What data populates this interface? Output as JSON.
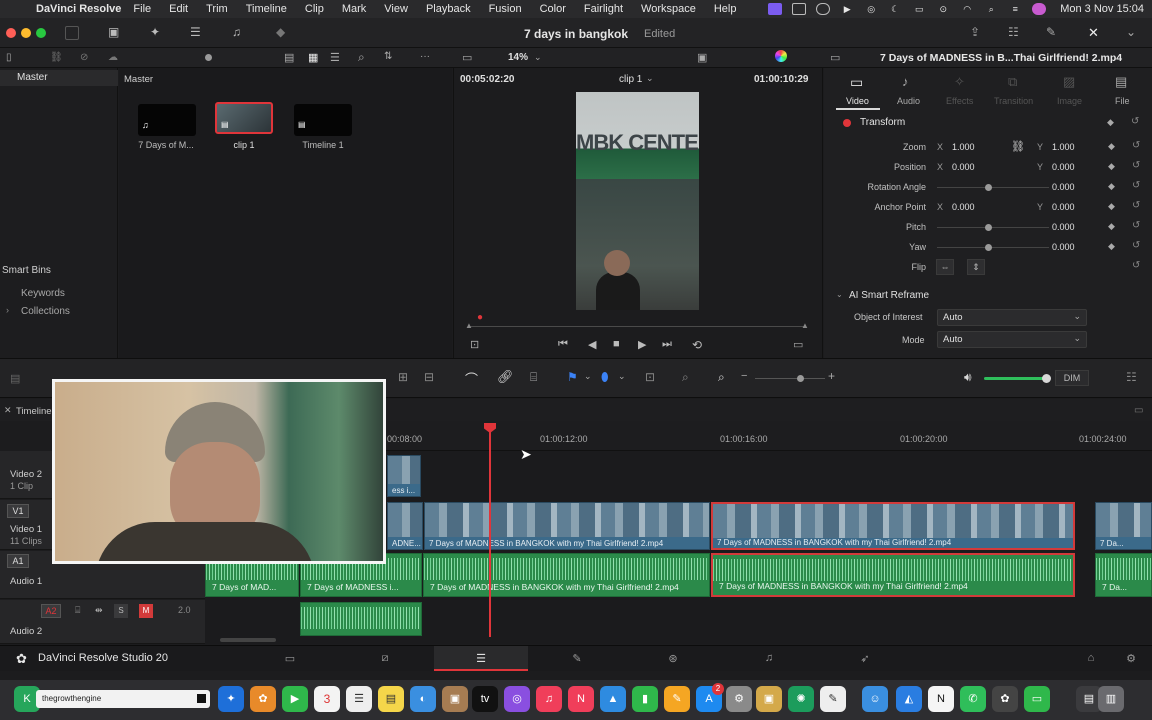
{
  "menubar": {
    "app_name": "DaVinci Resolve",
    "items": [
      "File",
      "Edit",
      "Trim",
      "Timeline",
      "Clip",
      "Mark",
      "View",
      "Playback",
      "Fusion",
      "Color",
      "Fairlight",
      "Workspace",
      "Help"
    ],
    "clock": "Mon 3 Nov  15:04"
  },
  "toolbar": {
    "project_title": "7 days in bangkok",
    "edited_label": "Edited"
  },
  "media_pool": {
    "header_left": "Master",
    "header_right": "Master",
    "smart_bins": "Smart Bins",
    "keywords": "Keywords",
    "collections": "Collections",
    "clips": [
      {
        "name": "7 Days of M..."
      },
      {
        "name": "clip 1"
      },
      {
        "name": "Timeline 1"
      }
    ]
  },
  "viewer": {
    "zoom": "14%",
    "timecode_left": "00:05:02:20",
    "clip_name": "clip 1",
    "timecode_right": "01:00:10:29",
    "sign_text": "MBK CENTER"
  },
  "inspector": {
    "clip_title": "7 Days of MADNESS in B...Thai Girlfriend! 2.mp4",
    "tabs": [
      "Video",
      "Audio",
      "Effects",
      "Transition",
      "Image",
      "File"
    ],
    "section_transform": "Transform",
    "rows": [
      {
        "name": "Zoom",
        "x_label": "X",
        "x": "1.000",
        "y_label": "Y",
        "y": "1.000"
      },
      {
        "name": "Position",
        "x_label": "X",
        "x": "0.000",
        "y_label": "Y",
        "y": "0.000"
      },
      {
        "name": "Rotation Angle",
        "y": "0.000"
      },
      {
        "name": "Anchor Point",
        "x_label": "X",
        "x": "0.000",
        "y_label": "Y",
        "y": "0.000"
      },
      {
        "name": "Pitch",
        "y": "0.000"
      },
      {
        "name": "Yaw",
        "y": "0.000"
      },
      {
        "name": "Flip"
      }
    ],
    "section_reframe": "AI Smart Reframe",
    "object_label": "Object of Interest",
    "object_value": "Auto",
    "mode_label": "Mode",
    "mode_value": "Auto"
  },
  "timeline": {
    "tab_label": "Timeline",
    "ruler": [
      "00:08:00",
      "01:00:12:00",
      "01:00:16:00",
      "01:00:20:00",
      "01:00:24:00"
    ],
    "dim_label": "DIM",
    "tracks": {
      "v2": {
        "name": "Video 2",
        "clips": "1 Clip"
      },
      "v1": {
        "code": "V1",
        "name": "Video 1",
        "clips": "11 Clips"
      },
      "a1": {
        "code": "A1",
        "name": "Audio 1"
      },
      "a2": {
        "code": "A2",
        "name": "Audio 2",
        "s": "S",
        "m": "M",
        "level": "2.0"
      }
    },
    "v2_clip_caption": "ess i...",
    "v1_clips": [
      "ADNE...",
      "7 Days of MADNESS in BANGKOK with my Thai Girlfriend! 2.mp4",
      "7 Days of MADNESS in BANGKOK with my Thai Girlfriend! 2.mp4",
      "7 Da..."
    ],
    "a1_clips": [
      "7 Days of MAD...",
      "7 Days of MADNESS i...",
      "7 Days of MADNESS in BANGKOK with my Thai Girlfriend! 2.mp4",
      "7 Days of MADNESS in BANGKOK with my Thai Girlfriend! 2.mp4",
      "7 Da..."
    ]
  },
  "pagebar": {
    "app_label": "DaVinci Resolve Studio 20"
  },
  "dock": {
    "webcam_label": "thegrowthengine",
    "calendar_day": "3",
    "badge": "2"
  }
}
